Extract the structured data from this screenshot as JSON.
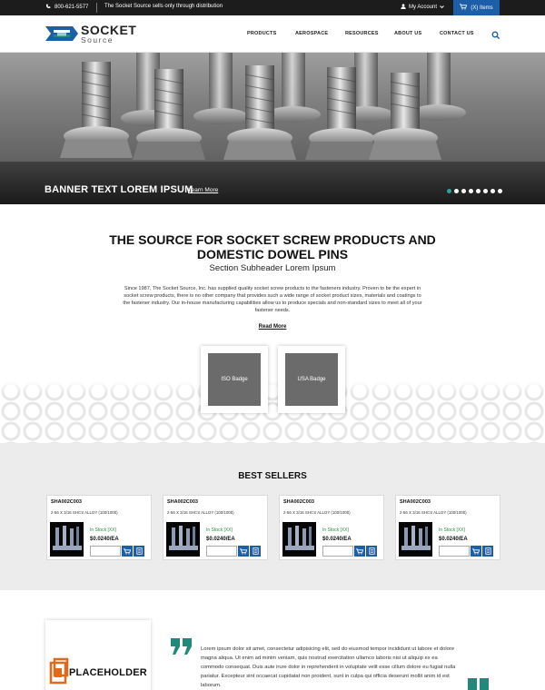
{
  "topbar": {
    "phone": "800-621-5577",
    "distribution_note": "The Socket Source sells only through distribution",
    "account_label": "My Account",
    "cart_label": "(X) Items"
  },
  "header": {
    "logo_line1": "SOCKET",
    "logo_line2": "Source",
    "nav": [
      "PRODUCTS",
      "AEROSPACE",
      "RESOURCES",
      "ABOUT US",
      "CONTACT US"
    ]
  },
  "hero": {
    "banner_text": "BANNER TEXT LOREM IPSUM",
    "link_text": "Learn More",
    "slide_count": 8,
    "active_slide": 1
  },
  "intro": {
    "heading_line1": "THE SOURCE FOR SOCKET SCREW PRODUCTS AND",
    "heading_line2": "DOMESTIC DOWEL PINS",
    "subheader": "Section Subheader Lorem Ipsum",
    "paragraph": "Since 1987, The Socket Source, Inc. has supplied quality socket screw products to the fasteners industry. Proven to be the expert in socket screw products, there is no other company that provides such a wide range of socket product sizes, materials and coatings to the fastener industry. Our in-house manufacturing capabilities allow us to produce specials and non-standard sizes to meet all of your fastener needs.",
    "read_more": "Read More",
    "badges": [
      "ISO Badge",
      "USA Badge"
    ]
  },
  "best_sellers": {
    "title": "BEST SELLERS",
    "products": [
      {
        "sku": "SHA002C003",
        "desc": "2-56 X 3/16 SHCS ALLOY (100/1000)",
        "stock": "In Stock [XX]",
        "price": "$0.0240/EA"
      },
      {
        "sku": "SHA002C003",
        "desc": "2-56 X 3/16 SHCS ALLOY (100/1000)",
        "stock": "In Stock [XX]",
        "price": "$0.0240/EA"
      },
      {
        "sku": "SHA002C003",
        "desc": "2-56 X 3/16 SHCS ALLOY (100/1000)",
        "stock": "In Stock [XX]",
        "price": "$0.0240/EA"
      },
      {
        "sku": "SHA002C003",
        "desc": "2-56 X 3/16 SHCS ALLOY (100/1000)",
        "stock": "In Stock [XX]",
        "price": "$0.0240/EA"
      }
    ]
  },
  "testimonial": {
    "placeholder_label": "PLACEHOLDER",
    "quote": "Lorem ipsum dolor sit amet, consectetur adipisicing elit, sed do eiusmod tempor incididunt ut labore et dolore magna aliqua. Ut enim ad minim veniam, quis nostrud exercitation ullamco laboris nisi ut aliquip ex ea commodo consequat. Duis aute irure dolor in reprehenderit in voluptate velit esse cillum dolore eu fugiat nulla pariatur. Excepteur sint occaecat cupidatat non proident, sunt in culpa qui officia deserunt mollit anim id est laborum."
  },
  "colors": {
    "brand_blue": "#1d5ea8",
    "accent_teal": "#1f8a7c",
    "topbar_dark": "#1c1c1c",
    "stock_green": "#2e8b3e"
  },
  "icons": [
    "phone-icon",
    "user-icon",
    "cart-icon",
    "search-icon",
    "add-to-cart-icon",
    "add-to-list-icon",
    "quote-icon"
  ]
}
